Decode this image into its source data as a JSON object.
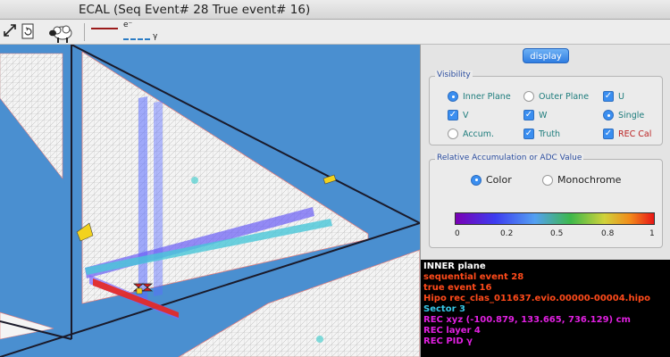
{
  "window": {
    "title": "ECAL  (Seq Event# 28  True event# 16)"
  },
  "toolbar": {
    "icons": [
      "expand-arrow-icon",
      "refresh-page-icon",
      "sheep-icon"
    ],
    "legend": [
      {
        "label": "e⁻",
        "color": "#9b1b1b",
        "style": "solid"
      },
      {
        "label": "γ",
        "color": "#2b7cc4",
        "style": "dashed"
      }
    ]
  },
  "panel": {
    "display_button": "display",
    "visibility": {
      "title": "Visibility",
      "options": [
        {
          "label": "Inner Plane",
          "kind": "radio",
          "on": true
        },
        {
          "label": "Outer Plane",
          "kind": "radio",
          "on": false
        },
        {
          "label": "U",
          "kind": "check",
          "on": true
        },
        {
          "label": "V",
          "kind": "check",
          "on": true
        },
        {
          "label": "W",
          "kind": "check",
          "on": true
        },
        {
          "label": "Single",
          "kind": "radio",
          "on": true
        },
        {
          "label": "Accum.",
          "kind": "radio",
          "on": false
        },
        {
          "label": "Truth",
          "kind": "check",
          "on": true
        },
        {
          "label": "REC Cal",
          "kind": "check",
          "on": true
        }
      ]
    },
    "accumulation": {
      "title": "Relative Accumulation or ADC Value",
      "color_label": "Color",
      "color_on": true,
      "mono_label": "Monochrome",
      "mono_on": false,
      "ticks": [
        "0",
        "0.2",
        "0.5",
        "0.8",
        "1"
      ]
    }
  },
  "info": {
    "lines": [
      {
        "text": "INNER plane",
        "color": "#ffffff"
      },
      {
        "text": "sequential event 28",
        "color": "#ff4a1a"
      },
      {
        "text": "true event 16",
        "color": "#ff4a1a"
      },
      {
        "text": "Hipo rec_clas_011637.evio.00000-00004.hipo",
        "color": "#ff4a1a"
      },
      {
        "text": "Sector 3",
        "color": "#38c8e8"
      },
      {
        "text": "REC xyz (-100.879, 133.665, 736.129) cm",
        "color": "#e020e0"
      },
      {
        "text": "REC layer 4",
        "color": "#e020e0"
      },
      {
        "text": "REC PID γ",
        "color": "#e020e0"
      }
    ]
  }
}
